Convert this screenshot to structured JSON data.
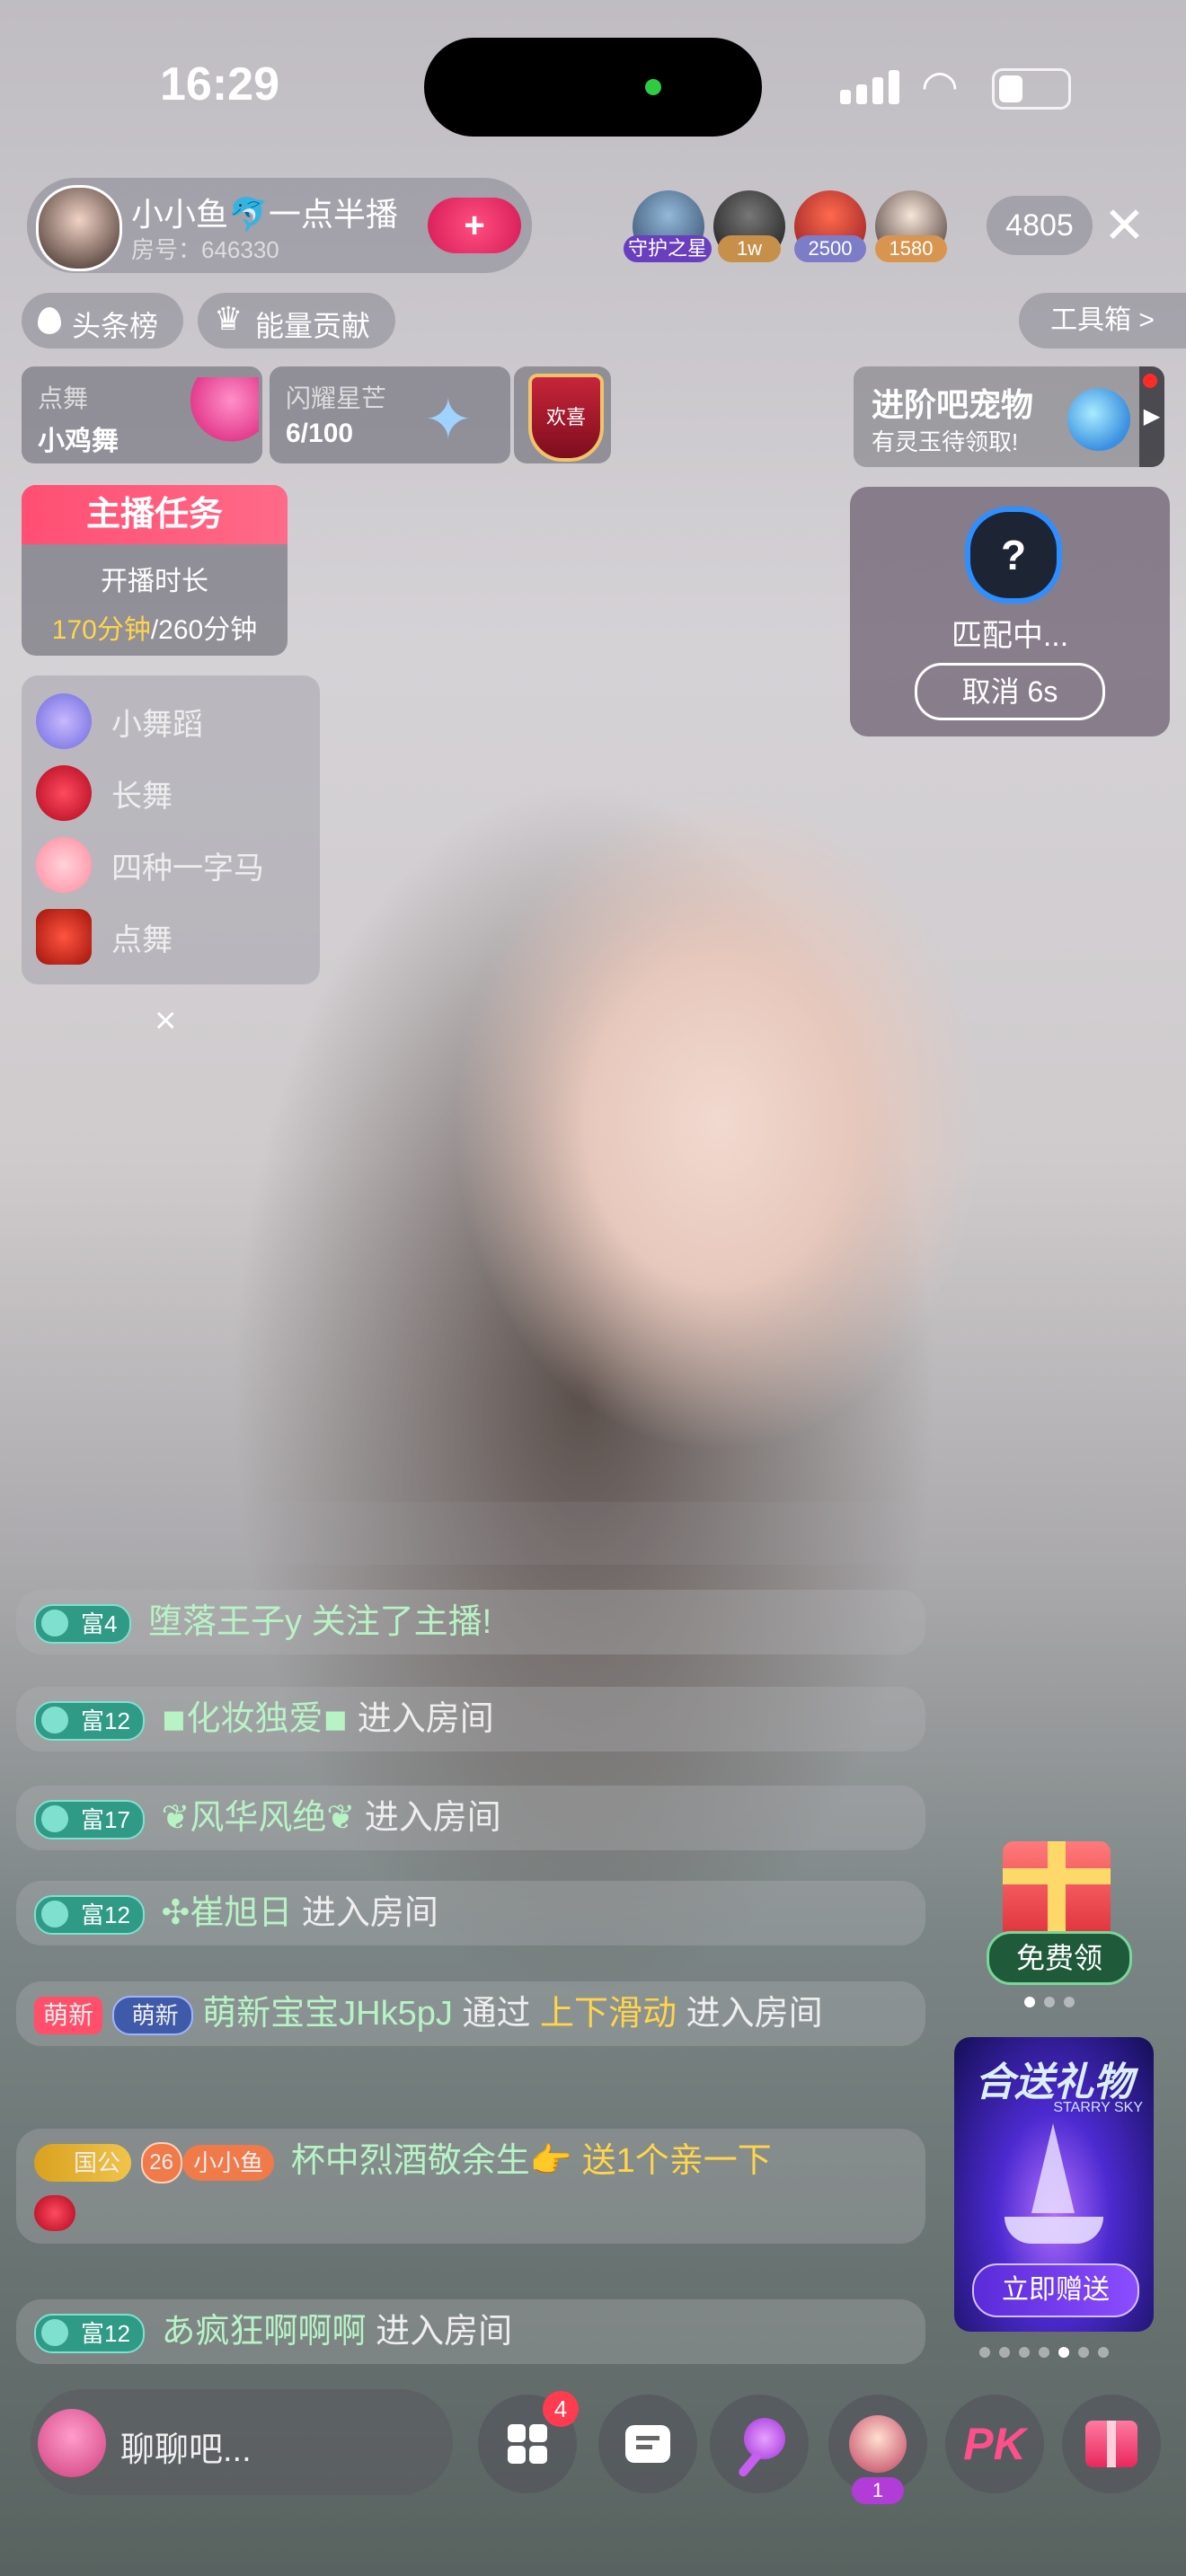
{
  "status_bar": {
    "time": "16:29"
  },
  "host": {
    "name": "小小鱼🐬一点半播",
    "room_label": "房号：646330",
    "follow_symbol": "+"
  },
  "viewers": {
    "badges": [
      "守护之星",
      "1w",
      "2500",
      "1580"
    ],
    "count": "4805"
  },
  "tags": {
    "headline": "头条榜",
    "energy": "能量贡献",
    "toolbox": "工具箱 >"
  },
  "info_cards": {
    "dance": {
      "label": "点舞",
      "value": "小鸡舞"
    },
    "star": {
      "label": "闪耀星芒",
      "value": "6/100"
    },
    "medal": "欢喜",
    "pet": {
      "title": "进阶吧宠物",
      "subtitle": "有灵玉待领取!"
    }
  },
  "task": {
    "header": "主播任务",
    "label": "开播时长",
    "progress_current": "170分钟",
    "progress_total": "/260分钟"
  },
  "match": {
    "status": "匹配中...",
    "cancel": "取消 6s",
    "symbol": "?"
  },
  "dance_menu": {
    "items": [
      "小舞蹈",
      "长舞",
      "四种一字马",
      "点舞"
    ],
    "close": "×"
  },
  "chat": {
    "row1": {
      "badge": "富4",
      "user": "堕落王子y",
      "action": "关注了主播!"
    },
    "row2": {
      "badge": "富12",
      "user": "◾化妆独爱◾",
      "action": "进入房间"
    },
    "row3": {
      "badge": "富17",
      "user": "❦风华风绝❦",
      "action": "进入房间"
    },
    "row4": {
      "badge": "富12",
      "user": "✣崔旭日",
      "action": "进入房间"
    },
    "row5": {
      "badge_a": "萌新",
      "badge_b": "萌新",
      "user": "萌新宝宝JHk5pJ",
      "mid": "通过",
      "highlight": "上下滑动",
      "action": "进入房间"
    },
    "row6": {
      "badge_a": "国公",
      "level": "26",
      "fan": "小小鱼",
      "user": "杯中烈酒敬余生👉",
      "action": "送1个亲一下"
    },
    "row7": {
      "badge": "富12",
      "user": "あ疯狂啊啊啊",
      "action": "进入房间"
    }
  },
  "promo": {
    "free_label": "免费领",
    "gift_title": "合送礼物",
    "gift_subtitle": "STARRY SKY",
    "gift_button": "立即赠送"
  },
  "bottom_bar": {
    "placeholder": "聊聊吧...",
    "apps_badge": "4",
    "pk": "PK",
    "guest_count": "1"
  }
}
